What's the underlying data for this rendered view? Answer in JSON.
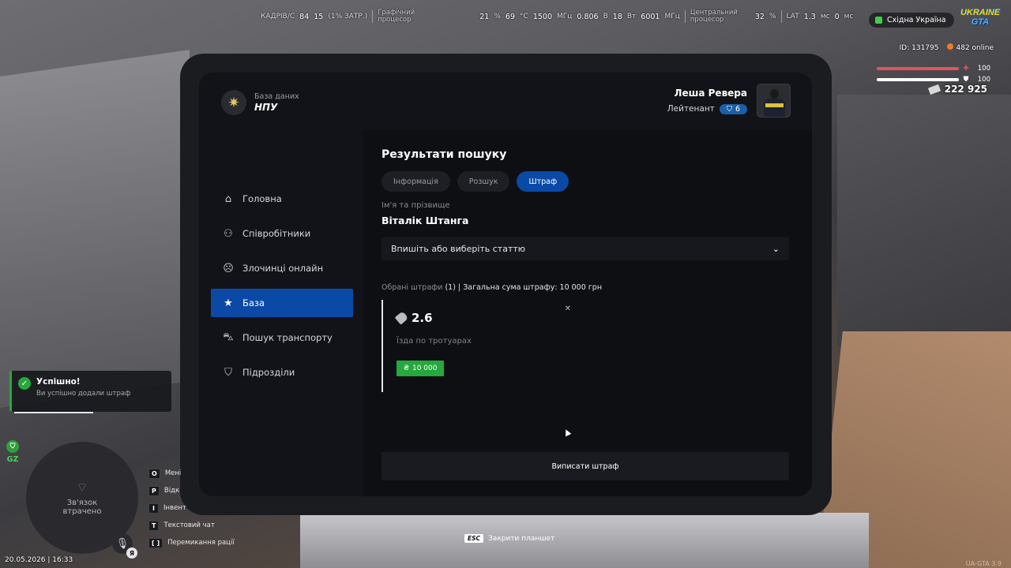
{
  "hud": {
    "fps_label": "КАДРІВ/С",
    "fps": "84",
    "fps_low": "15",
    "fps_low_note": "(1% ЗАТР.)",
    "gpu_label_1": "Графічний",
    "gpu_label_2": "процесор",
    "gpu_load": "21",
    "gpu_temp": "69",
    "gpu_clock": "1500",
    "gpu_volt": "0.806",
    "gpu_power": "18",
    "gpu_mem": "6001",
    "cpu_label_1": "Центральний",
    "cpu_label_2": "процесор",
    "cpu_load": "32",
    "lat_label": "LAT",
    "lat_1": "1.3",
    "lat_2": "0",
    "unit_pct": "%",
    "unit_c": "°C",
    "unit_mhz": "МГц",
    "unit_v": "В",
    "unit_w": "Вт",
    "unit_ms": "мс",
    "region": "Східна Україна",
    "logo_line1": "UKRAINE",
    "logo_line2": "GTA",
    "player_id": "ID: 131795",
    "online": "482 online",
    "health": 100,
    "armor": 100,
    "health_text": "100",
    "armor_text": "100",
    "money": "222 925",
    "colors": {
      "health": "#e8505b",
      "armor": "#ffffff",
      "accent": "#0a4aa6",
      "success": "#25a83d"
    }
  },
  "tablet": {
    "brand_sub": "База даних",
    "brand_title": "НПУ",
    "nav": [
      {
        "label": "Головна",
        "icon": "home-icon"
      },
      {
        "label": "Співробітники",
        "icon": "users-icon"
      },
      {
        "label": "Злочинці онлайн",
        "icon": "mask-icon"
      },
      {
        "label": "База",
        "icon": "star-icon",
        "active": true
      },
      {
        "label": "Пошук транспорту",
        "icon": "car-icon"
      },
      {
        "label": "Підрозділи",
        "icon": "shield-icon"
      }
    ],
    "profile": {
      "name": "Леша Ревера",
      "rank": "Лейтенант",
      "level": "6"
    },
    "title": "Результати пошуку",
    "tabs": [
      "Інформація",
      "Розшук",
      "Штраф"
    ],
    "active_tab": "Штраф",
    "name_label": "Ім'я та прізвище",
    "name_value": "Віталік Штанга",
    "select_placeholder": "Впишіть або виберіть статтю",
    "summary_prefix": "Обрані штрафи",
    "summary_count": "(1)",
    "summary_total": "| Загальна сума штрафу: 10 000 грн",
    "fine": {
      "article": "2.6",
      "description": "Їзда по тротуарах",
      "amount": "10 000",
      "currency": "₴"
    },
    "submit_label": "Виписати штраф"
  },
  "notification": {
    "title": "Успішно!",
    "text": "Ви успішно додали штраф"
  },
  "minimap": {
    "zone": "GZ",
    "status_1": "Зв'язок",
    "status_2": "втрачено",
    "voice_badge": "Я"
  },
  "keys": [
    {
      "key": "O",
      "label": "Мені"
    },
    {
      "key": "P",
      "label": "Відк"
    },
    {
      "key": "I",
      "label": "Інвент"
    },
    {
      "key": "T",
      "label": "Текстовий чат"
    },
    {
      "key": "[ ]",
      "label": "Перемикання рації"
    }
  ],
  "esc": {
    "key": "ESC",
    "label": "Закрити планшет"
  },
  "datetime": "20.05.2026 | 16:33",
  "version": "UA-GTA 3.9"
}
